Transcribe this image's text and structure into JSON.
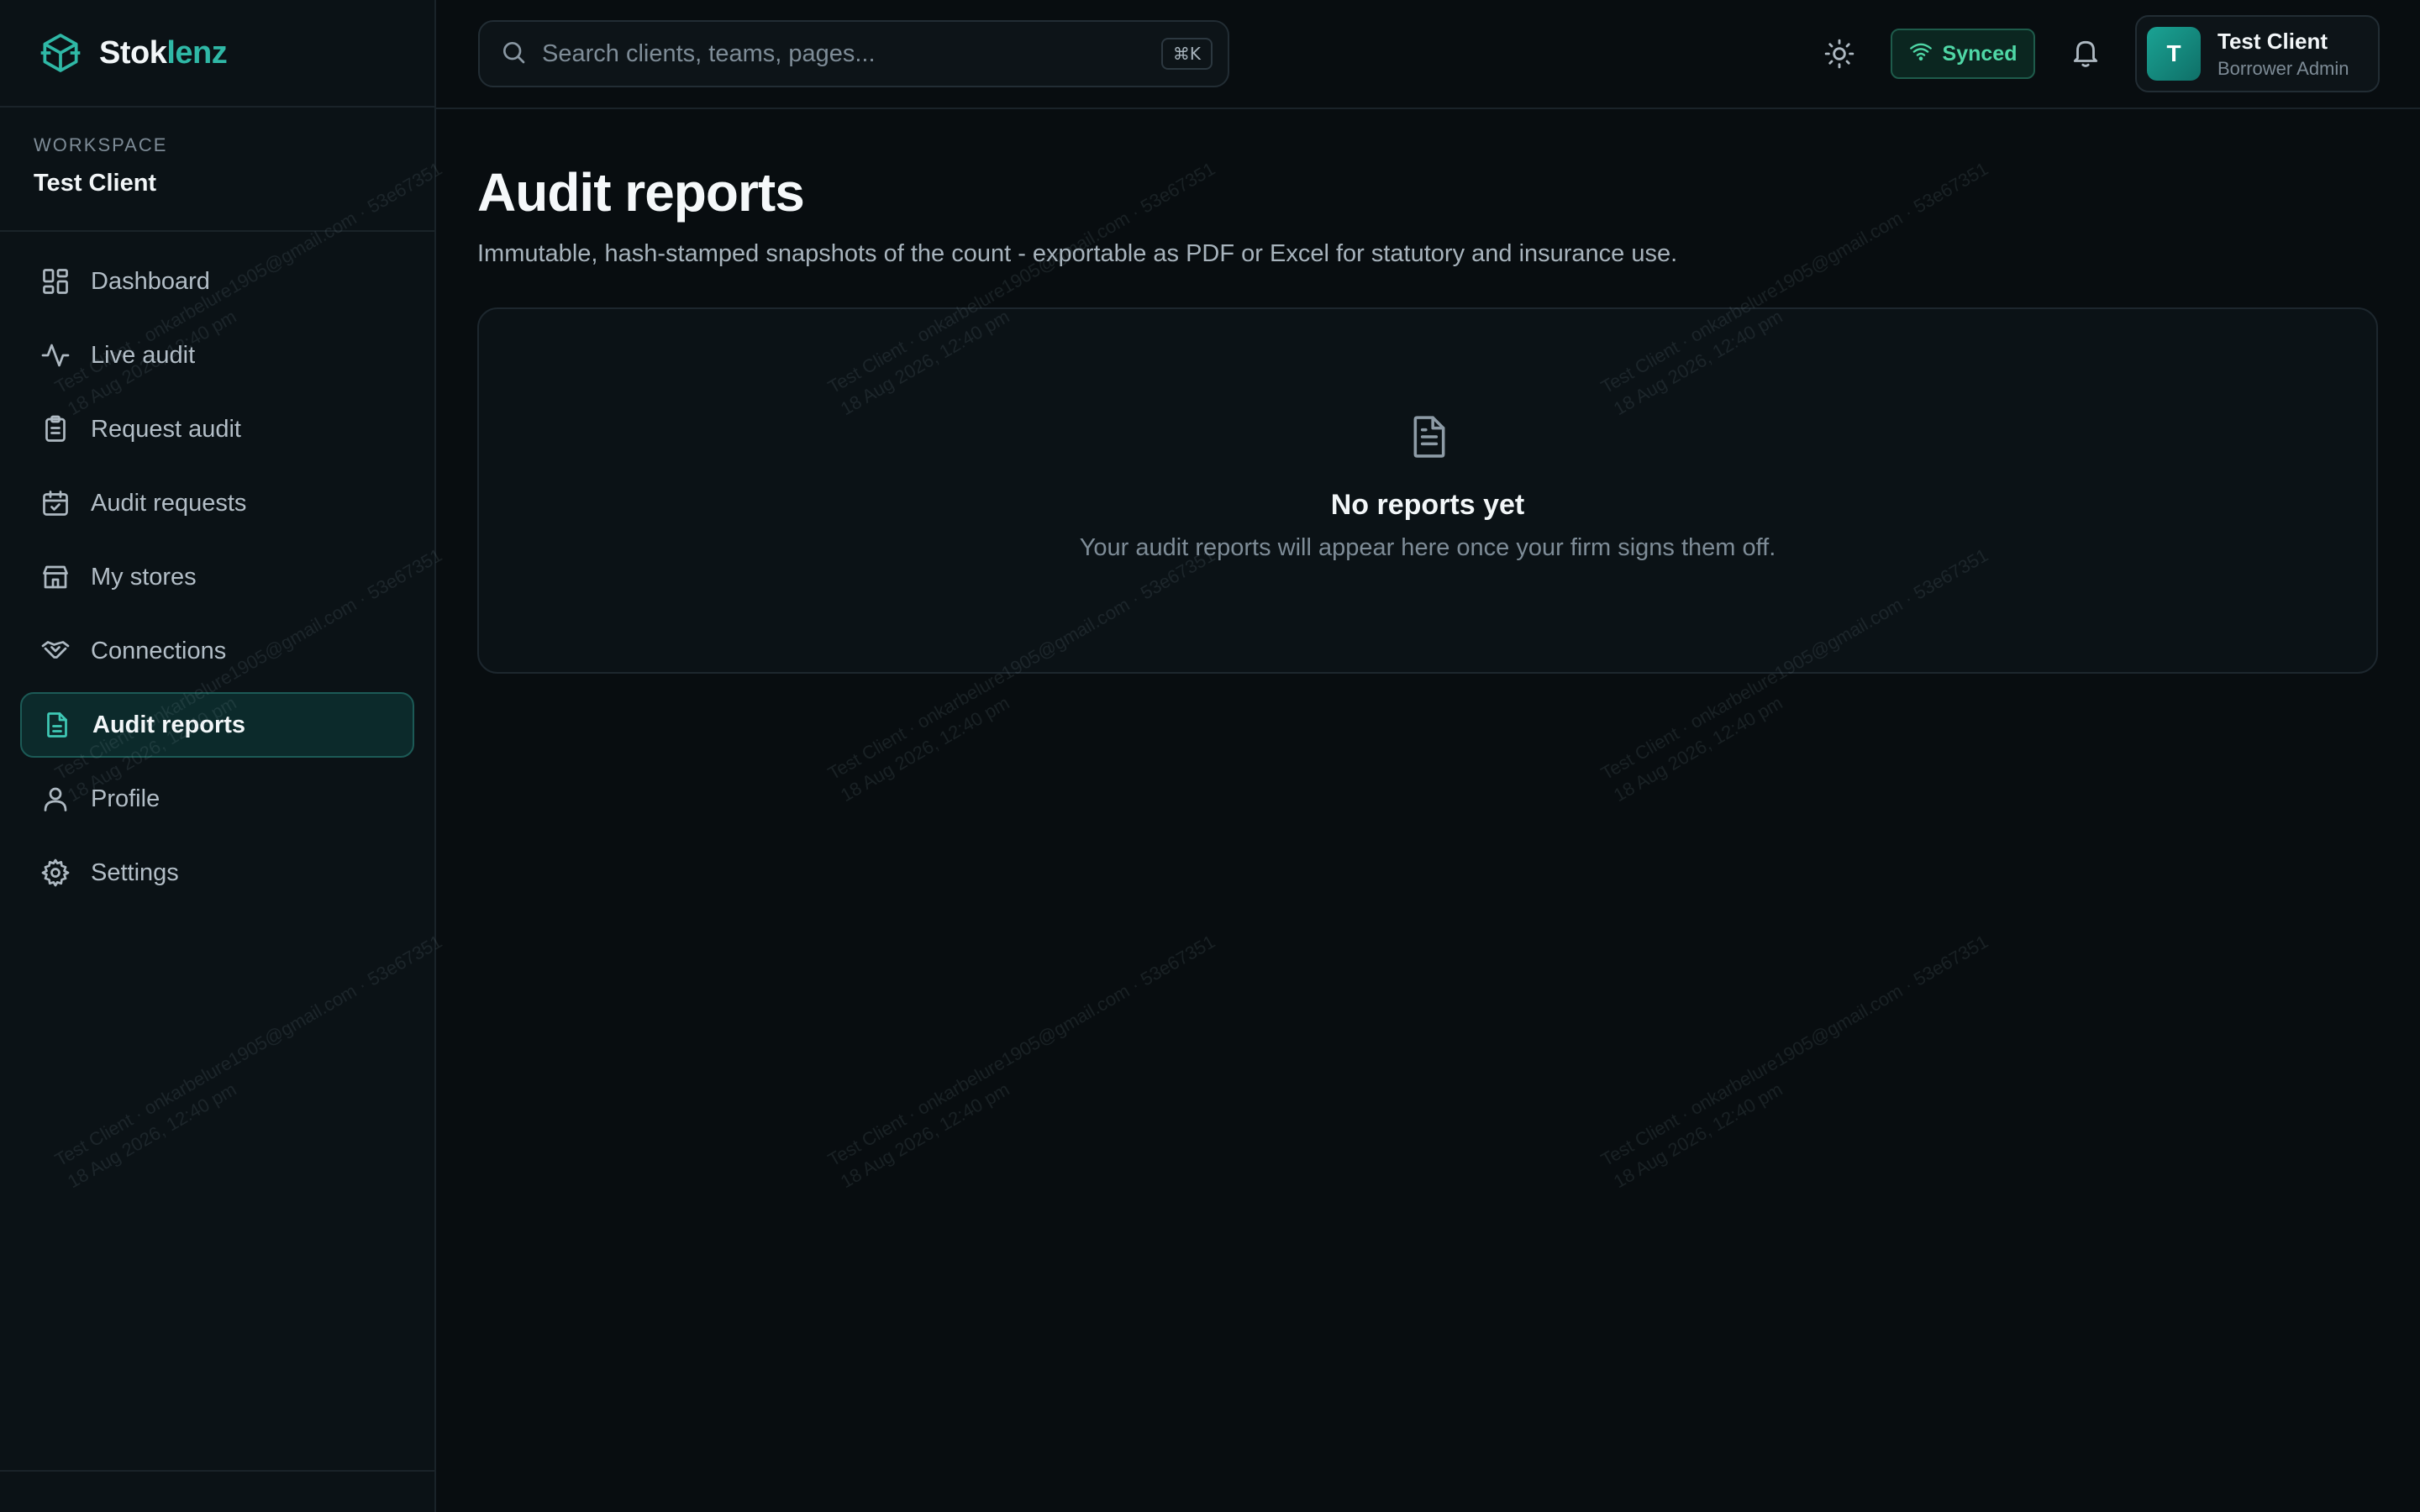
{
  "brand": {
    "name_part1": "Stok",
    "name_part2": "lenz",
    "logo_icon": "cube-box-icon"
  },
  "workspace": {
    "label": "WORKSPACE",
    "name": "Test Client"
  },
  "sidebar": {
    "items": [
      {
        "label": "Dashboard",
        "icon": "grid-icon",
        "active": false
      },
      {
        "label": "Live audit",
        "icon": "activity-icon",
        "active": false
      },
      {
        "label": "Request audit",
        "icon": "clipboard-list-icon",
        "active": false
      },
      {
        "label": "Audit requests",
        "icon": "calendar-check-icon",
        "active": false
      },
      {
        "label": "My stores",
        "icon": "store-icon",
        "active": false
      },
      {
        "label": "Connections",
        "icon": "handshake-icon",
        "active": false
      },
      {
        "label": "Audit reports",
        "icon": "file-text-icon",
        "active": true
      },
      {
        "label": "Profile",
        "icon": "user-icon",
        "active": false
      },
      {
        "label": "Settings",
        "icon": "gear-icon",
        "active": false
      }
    ]
  },
  "topbar": {
    "search_placeholder": "Search clients, teams, pages...",
    "search_shortcut": "⌘K",
    "sync_status": "Synced",
    "user": {
      "initial": "T",
      "name": "Test Client",
      "role": "Borrower Admin"
    }
  },
  "main": {
    "title": "Audit reports",
    "subtitle": "Immutable, hash-stamped snapshots of the count - exportable as PDF or Excel for statutory and insurance use.",
    "empty_state": {
      "title": "No reports yet",
      "message": "Your audit reports will appear here once your firm signs them off."
    }
  },
  "watermark": {
    "line1": "Test Client · onkarbelure1905@gmail.com · 53e67351",
    "line2": "18 Aug 2026, 12:40 pm"
  },
  "colors": {
    "accent": "#2fb8a6",
    "background": "#080d10",
    "sidebar": "#0b1216",
    "synced": "#4fd7a6"
  }
}
